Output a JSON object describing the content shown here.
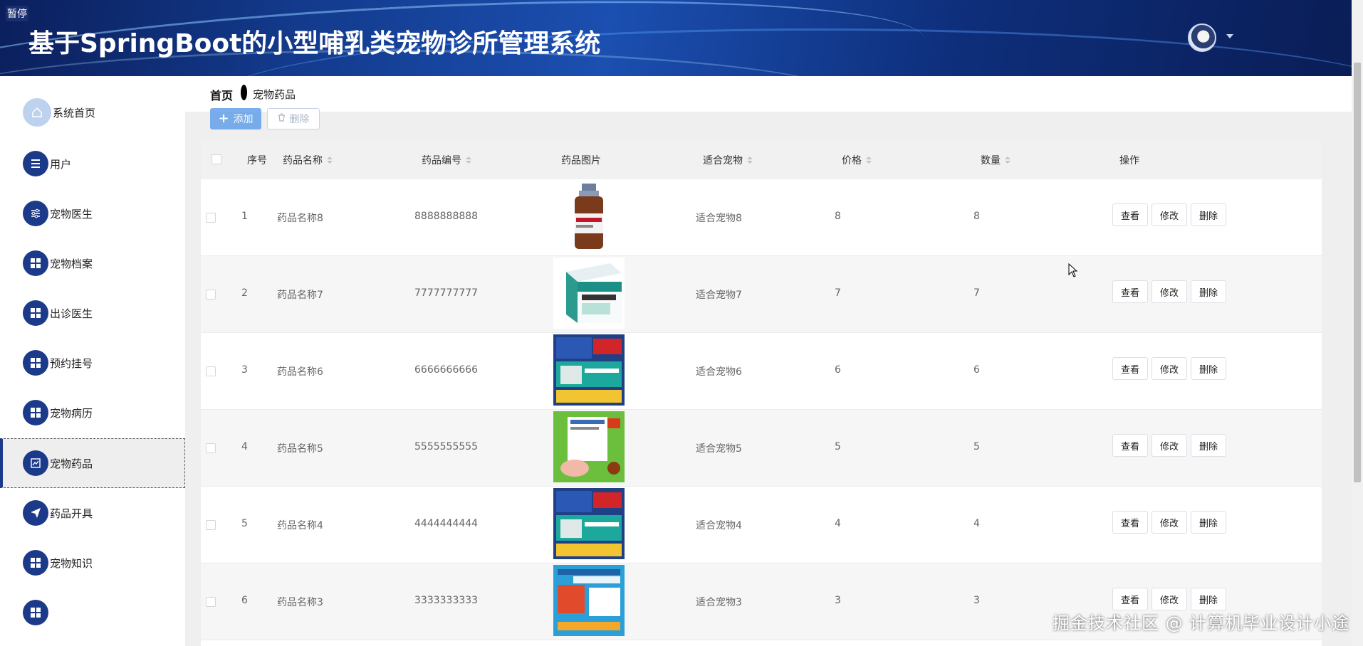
{
  "header": {
    "badge": "暂停",
    "title": "基于SpringBoot的小型哺乳类宠物诊所管理系统",
    "avatar_icon": "user-avatar",
    "brand_color": "#133a8c"
  },
  "sidebar": {
    "items": [
      {
        "label": "系统首页",
        "icon": "home-icon"
      },
      {
        "label": "用户",
        "icon": "list-icon"
      },
      {
        "label": "宠物医生",
        "icon": "sliders-icon"
      },
      {
        "label": "宠物档案",
        "icon": "grid-icon"
      },
      {
        "label": "出诊医生",
        "icon": "grid-icon"
      },
      {
        "label": "预约挂号",
        "icon": "grid-icon"
      },
      {
        "label": "宠物病历",
        "icon": "grid-icon"
      },
      {
        "label": "宠物药品",
        "icon": "chart-icon",
        "active": true
      },
      {
        "label": "药品开具",
        "icon": "send-icon"
      },
      {
        "label": "宠物知识",
        "icon": "grid-icon"
      }
    ]
  },
  "breadcrumb": {
    "home": "首页",
    "current": "宠物药品"
  },
  "toolbar": {
    "add_label": "添加",
    "delete_label": "删除"
  },
  "table": {
    "columns": {
      "index": "序号",
      "name": "药品名称",
      "code": "药品编号",
      "image": "药品图片",
      "pet": "适合宠物",
      "price": "价格",
      "qty": "数量",
      "ops": "操作"
    },
    "actions": {
      "view": "查看",
      "edit": "修改",
      "delete": "删除"
    },
    "rows": [
      {
        "index": "1",
        "name": "药品名称8",
        "code": "8888888888",
        "pet": "适合宠物8",
        "price": "8",
        "qty": "8",
        "image": "bottle"
      },
      {
        "index": "2",
        "name": "药品名称7",
        "code": "7777777777",
        "pet": "适合宠物7",
        "price": "7",
        "qty": "7",
        "image": "box"
      },
      {
        "index": "3",
        "name": "药品名称6",
        "code": "6666666666",
        "pet": "适合宠物6",
        "price": "6",
        "qty": "6",
        "image": "poster-blue"
      },
      {
        "index": "4",
        "name": "药品名称5",
        "code": "5555555555",
        "pet": "适合宠物5",
        "price": "5",
        "qty": "5",
        "image": "poster-green"
      },
      {
        "index": "5",
        "name": "药品名称4",
        "code": "4444444444",
        "pet": "适合宠物4",
        "price": "4",
        "qty": "4",
        "image": "poster-blue"
      },
      {
        "index": "6",
        "name": "药品名称3",
        "code": "3333333333",
        "pet": "适合宠物3",
        "price": "3",
        "qty": "3",
        "image": "poster-light"
      }
    ]
  },
  "watermark": "掘金技术社区 @ 计算机毕业设计小途"
}
